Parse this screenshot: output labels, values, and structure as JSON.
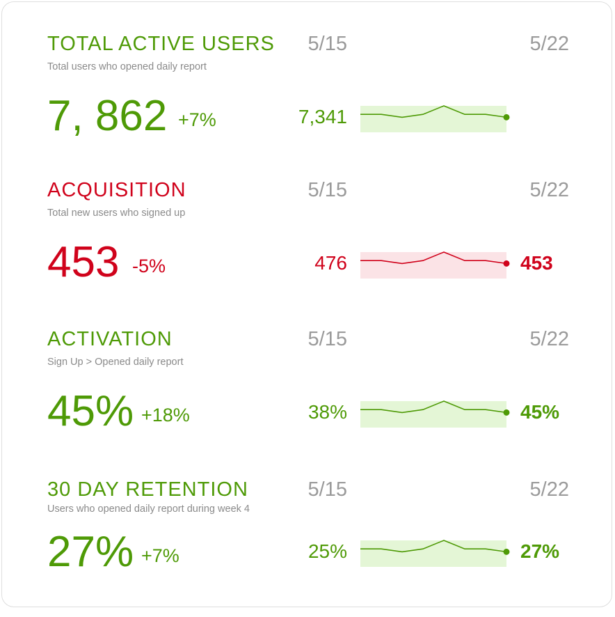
{
  "colors": {
    "positive": "#4e9a06",
    "negative": "#d0021b",
    "positive_band": "#e4f6d6",
    "negative_band": "#fbe3e6",
    "date": "#9a9a9a",
    "subtitle": "#8a8a8a"
  },
  "metrics": [
    {
      "title": "TOTAL ACTIVE USERS",
      "subtitle": "Total users who opened daily report",
      "value": "7, 862",
      "change": "+7%",
      "start_date": "5/15",
      "end_date": "5/22",
      "start_value": "7,341",
      "end_value": "",
      "trend": "positive",
      "sparkline": [
        0.53,
        0.53,
        0.37,
        0.53,
        1.0,
        0.53,
        0.53,
        0.37
      ]
    },
    {
      "title": "ACQUISITION",
      "subtitle": "Total new users who signed up",
      "value": "453",
      "change": "-5%",
      "start_date": "5/15",
      "end_date": "5/22",
      "start_value": "476",
      "end_value": "453",
      "trend": "negative",
      "sparkline": [
        0.53,
        0.53,
        0.37,
        0.53,
        1.0,
        0.53,
        0.53,
        0.37
      ]
    },
    {
      "title": "ACTIVATION",
      "subtitle": "Sign Up > Opened daily report",
      "value": "45%",
      "change": "+18%",
      "start_date": "5/15",
      "end_date": "5/22",
      "start_value": "38%",
      "end_value": "45%",
      "trend": "positive",
      "sparkline": [
        0.53,
        0.53,
        0.37,
        0.53,
        1.0,
        0.53,
        0.53,
        0.37
      ]
    },
    {
      "title": "30 DAY RETENTION",
      "subtitle": "Users who opened daily report during week 4",
      "value": "27%",
      "change": "+7%",
      "start_date": "5/15",
      "end_date": "5/22",
      "start_value": "25%",
      "end_value": "27%",
      "trend": "positive",
      "sparkline": [
        0.53,
        0.53,
        0.37,
        0.53,
        1.0,
        0.53,
        0.53,
        0.37
      ]
    }
  ]
}
